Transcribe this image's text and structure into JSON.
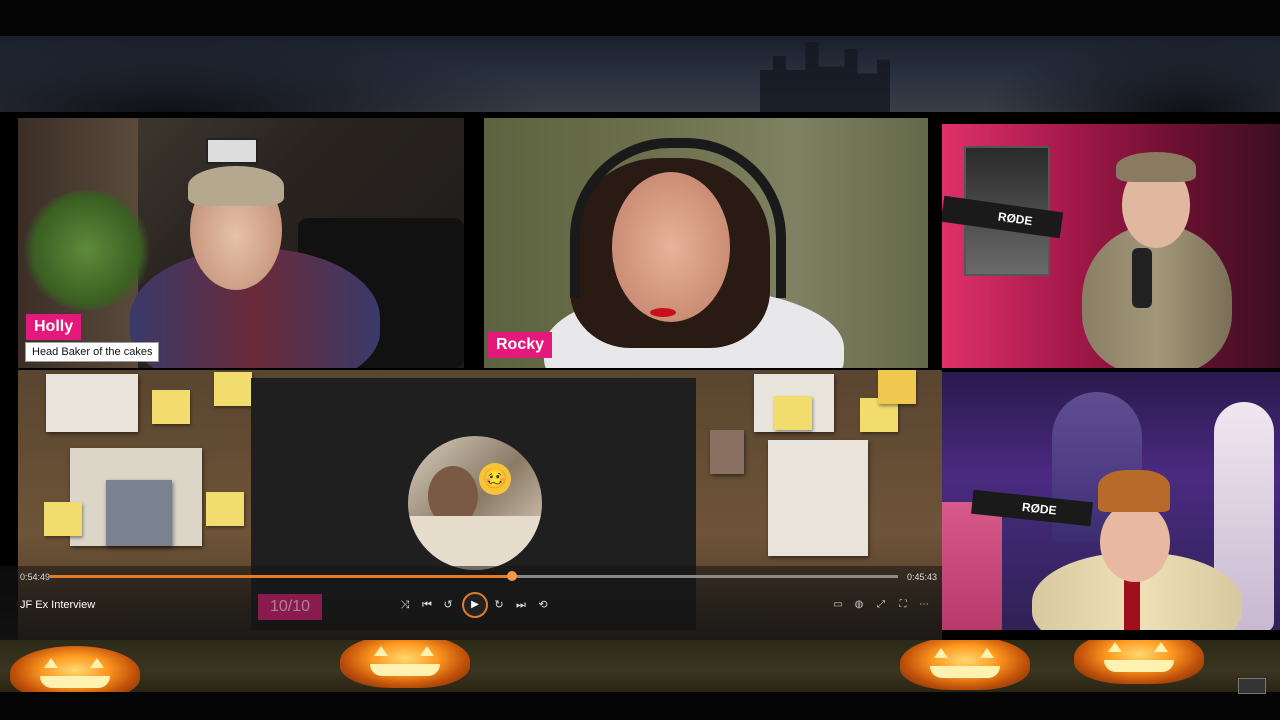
{
  "participants": {
    "holly": {
      "name": "Holly",
      "subtitle": "Head Baker of the cakes"
    },
    "rocky": {
      "name": "Rocky"
    }
  },
  "player": {
    "elapsed": "0:54:49",
    "remaining": "0:45:43",
    "progress": 0.545,
    "title": "JF Ex Interview",
    "counter": "10/10",
    "thumbnail_emoji": "🥴",
    "accent": "#e27b2a"
  },
  "controls": {
    "shuffle": "⤨",
    "previous": "⏮",
    "rewind": "↺",
    "play": "▶",
    "forward": "↻",
    "next": "⏭",
    "repeat": "⟲",
    "captions": "▭",
    "volume": "◍",
    "pip": "⤢",
    "fullscreen": "⛶",
    "more": "⋯"
  },
  "colors": {
    "name_tag": "#e5197c",
    "counter_bg": "#b01d62"
  }
}
